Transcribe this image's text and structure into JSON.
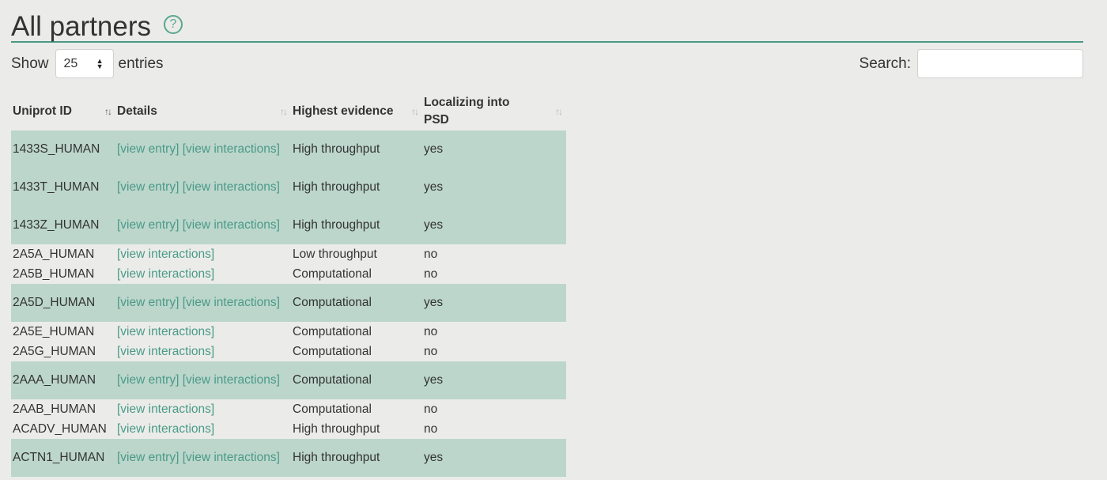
{
  "header": {
    "title": "All partners",
    "help_icon": "question-circle-icon"
  },
  "controls": {
    "show_label": "Show",
    "page_length": "25",
    "entries_label": "entries",
    "search_label": "Search:",
    "search_value": ""
  },
  "table": {
    "columns": [
      "Uniprot ID",
      "Details",
      "Highest evidence",
      "Localizing into PSD"
    ],
    "rows": [
      {
        "id": "1433S_HUMAN",
        "details": [
          "[view entry]",
          "[view interactions]"
        ],
        "evidence": "High throughput",
        "psd": "yes"
      },
      {
        "id": "1433T_HUMAN",
        "details": [
          "[view entry]",
          "[view interactions]"
        ],
        "evidence": "High throughput",
        "psd": "yes"
      },
      {
        "id": "1433Z_HUMAN",
        "details": [
          "[view entry]",
          "[view interactions]"
        ],
        "evidence": "High throughput",
        "psd": "yes"
      },
      {
        "id": "2A5A_HUMAN",
        "details": [
          "[view interactions]"
        ],
        "evidence": "Low throughput",
        "psd": "no"
      },
      {
        "id": "2A5B_HUMAN",
        "details": [
          "[view interactions]"
        ],
        "evidence": "Computational",
        "psd": "no"
      },
      {
        "id": "2A5D_HUMAN",
        "details": [
          "[view entry]",
          "[view interactions]"
        ],
        "evidence": "Computational",
        "psd": "yes"
      },
      {
        "id": "2A5E_HUMAN",
        "details": [
          "[view interactions]"
        ],
        "evidence": "Computational",
        "psd": "no"
      },
      {
        "id": "2A5G_HUMAN",
        "details": [
          "[view interactions]"
        ],
        "evidence": "Computational",
        "psd": "no"
      },
      {
        "id": "2AAA_HUMAN",
        "details": [
          "[view entry]",
          "[view interactions]"
        ],
        "evidence": "Computational",
        "psd": "yes"
      },
      {
        "id": "2AAB_HUMAN",
        "details": [
          "[view interactions]"
        ],
        "evidence": "Computational",
        "psd": "no"
      },
      {
        "id": "ACADV_HUMAN",
        "details": [
          "[view interactions]"
        ],
        "evidence": "High throughput",
        "psd": "no"
      },
      {
        "id": "ACTN1_HUMAN",
        "details": [
          "[view entry]",
          "[view interactions]"
        ],
        "evidence": "High throughput",
        "psd": "yes"
      }
    ]
  },
  "colors": {
    "accent": "#4a9a86",
    "highlight_row": "#bcd6cc",
    "background": "#ebecea"
  }
}
